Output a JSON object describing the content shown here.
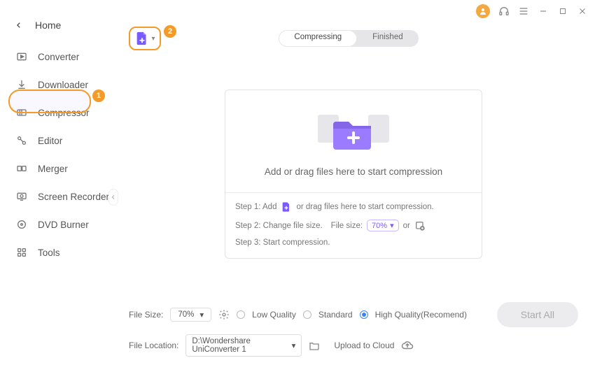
{
  "window": {
    "avatar_initial": ""
  },
  "sidebar": {
    "home_label": "Home",
    "items": [
      {
        "label": "Converter"
      },
      {
        "label": "Downloader"
      },
      {
        "label": "Compressor"
      },
      {
        "label": "Editor"
      },
      {
        "label": "Merger"
      },
      {
        "label": "Screen Recorder"
      },
      {
        "label": "DVD Burner"
      },
      {
        "label": "Tools"
      }
    ]
  },
  "callouts": {
    "one": "1",
    "two": "2"
  },
  "tabs": {
    "compressing": "Compressing",
    "finished": "Finished"
  },
  "dropzone": {
    "headline": "Add or drag files here to start compression",
    "step1_prefix": "Step 1: Add",
    "step1_suffix": "or drag files here to start compression.",
    "step2_prefix": "Step 2: Change file size.",
    "step2_label": "File size:",
    "step2_value": "70%",
    "step2_or": "or",
    "step3": "Step 3: Start compression."
  },
  "footer": {
    "filesize_label": "File Size:",
    "filesize_value": "70%",
    "quality": {
      "low": "Low Quality",
      "standard": "Standard",
      "high": "High Quality(Recomend)"
    },
    "location_label": "File Location:",
    "location_value": "D:\\Wondershare UniConverter 1",
    "upload_label": "Upload to Cloud",
    "start_label": "Start All"
  }
}
